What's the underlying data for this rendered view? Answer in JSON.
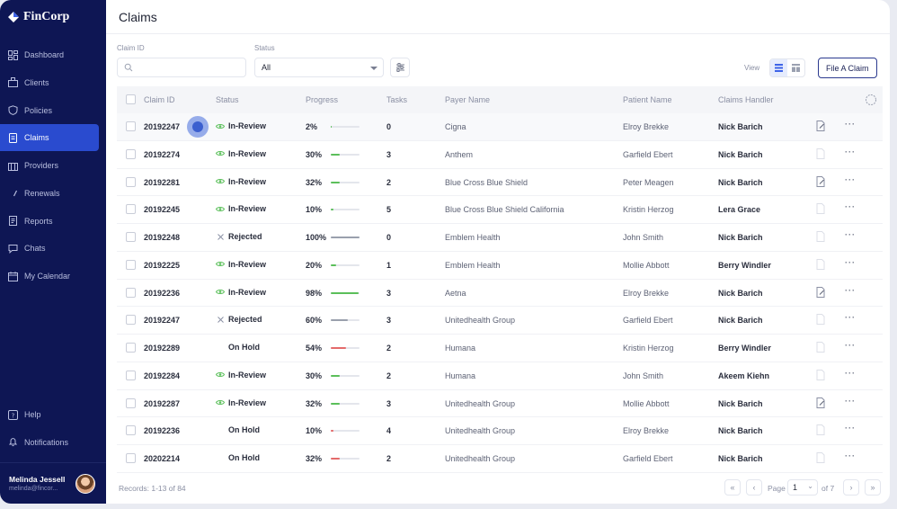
{
  "brand": {
    "name": "FinCorp"
  },
  "sidebar": {
    "items": [
      {
        "label": "Dashboard",
        "icon": "dashboard-icon"
      },
      {
        "label": "Clients",
        "icon": "clients-icon"
      },
      {
        "label": "Policies",
        "icon": "shield-icon"
      },
      {
        "label": "Claims",
        "icon": "claims-icon",
        "active": true
      },
      {
        "label": "Providers",
        "icon": "providers-icon"
      },
      {
        "label": "Renewals",
        "icon": "renewals-icon"
      },
      {
        "label": "Reports",
        "icon": "reports-icon"
      },
      {
        "label": "Chats",
        "icon": "chat-icon"
      },
      {
        "label": "My Calendar",
        "icon": "calendar-icon"
      }
    ],
    "bottom": [
      {
        "label": "Help",
        "icon": "help-icon"
      },
      {
        "label": "Notifications",
        "icon": "bell-icon"
      }
    ],
    "user": {
      "name": "Melinda Jessell",
      "email": "melinda@fincor..."
    }
  },
  "header": {
    "title": "Claims"
  },
  "filters": {
    "claim_id_label": "Claim ID",
    "claim_id_value": "",
    "status_label": "Status",
    "status_value": "All",
    "view_label": "View",
    "file_claim_label": "File A Claim"
  },
  "table": {
    "columns": [
      "Claim ID",
      "Status",
      "Progress",
      "Tasks",
      "Payer Name",
      "Patient Name",
      "Claims Handler"
    ],
    "rows": [
      {
        "id": "20192247",
        "status": "In-Review",
        "progress": "2%",
        "pct": 2,
        "tasks": "0",
        "payer": "Cigna",
        "patient": "Elroy Brekke",
        "handler": "Nick Barich",
        "doc": "edit"
      },
      {
        "id": "20192274",
        "status": "In-Review",
        "progress": "30%",
        "pct": 30,
        "tasks": "3",
        "payer": "Anthem",
        "patient": "Garfield Ebert",
        "handler": "Nick Barich",
        "doc": "plain"
      },
      {
        "id": "20192281",
        "status": "In-Review",
        "progress": "32%",
        "pct": 32,
        "tasks": "2",
        "payer": "Blue Cross Blue Shield",
        "patient": "Peter Meagen",
        "handler": "Nick Barich",
        "doc": "edit"
      },
      {
        "id": "20192245",
        "status": "In-Review",
        "progress": "10%",
        "pct": 10,
        "tasks": "5",
        "payer": "Blue Cross Blue Shield California",
        "patient": "Kristin Herzog",
        "handler": "Lera Grace",
        "doc": "plain"
      },
      {
        "id": "20192248",
        "status": "Rejected",
        "progress": "100%",
        "pct": 100,
        "tasks": "0",
        "payer": "Emblem Health",
        "patient": "John Smith",
        "handler": "Nick Barich",
        "doc": "plain"
      },
      {
        "id": "20192225",
        "status": "In-Review",
        "progress": "20%",
        "pct": 20,
        "tasks": "1",
        "payer": "Emblem Health",
        "patient": "Mollie Abbott",
        "handler": "Berry Windler",
        "doc": "plain"
      },
      {
        "id": "20192236",
        "status": "In-Review",
        "progress": "98%",
        "pct": 98,
        "tasks": "3",
        "payer": "Aetna",
        "patient": "Elroy Brekke",
        "handler": "Nick Barich",
        "doc": "edit"
      },
      {
        "id": "20192247",
        "status": "Rejected",
        "progress": "60%",
        "pct": 60,
        "tasks": "3",
        "payer": "Unitedhealth Group",
        "patient": "Garfield Ebert",
        "handler": "Nick Barich",
        "doc": "plain"
      },
      {
        "id": "20192289",
        "status": "On Hold",
        "progress": "54%",
        "pct": 54,
        "tasks": "2",
        "payer": "Humana",
        "patient": "Kristin Herzog",
        "handler": "Berry Windler",
        "doc": "plain"
      },
      {
        "id": "20192284",
        "status": "In-Review",
        "progress": "30%",
        "pct": 30,
        "tasks": "2",
        "payer": "Humana",
        "patient": "John Smith",
        "handler": "Akeem Kiehn",
        "doc": "plain"
      },
      {
        "id": "20192287",
        "status": "In-Review",
        "progress": "32%",
        "pct": 32,
        "tasks": "3",
        "payer": "Unitedhealth Group",
        "patient": "Mollie Abbott",
        "handler": "Nick Barich",
        "doc": "edit"
      },
      {
        "id": "20192236",
        "status": "On Hold",
        "progress": "10%",
        "pct": 10,
        "tasks": "4",
        "payer": "Unitedhealth Group",
        "patient": "Elroy Brekke",
        "handler": "Nick Barich",
        "doc": "plain"
      },
      {
        "id": "20202214",
        "status": "On Hold",
        "progress": "32%",
        "pct": 32,
        "tasks": "2",
        "payer": "Unitedhealth Group",
        "patient": "Garfield Ebert",
        "handler": "Nick Barich",
        "doc": "plain"
      }
    ]
  },
  "footer": {
    "records": "Records: 1-13 of 84",
    "page_label": "Page",
    "page_value": "1",
    "page_total": "of 7"
  },
  "colors": {
    "sidebar_bg": "#0e1654",
    "active_nav": "#2a4bcf",
    "in_review": "#5bbf5a",
    "rejected": "#9aa0ad",
    "on_hold": "#e46a6a"
  }
}
